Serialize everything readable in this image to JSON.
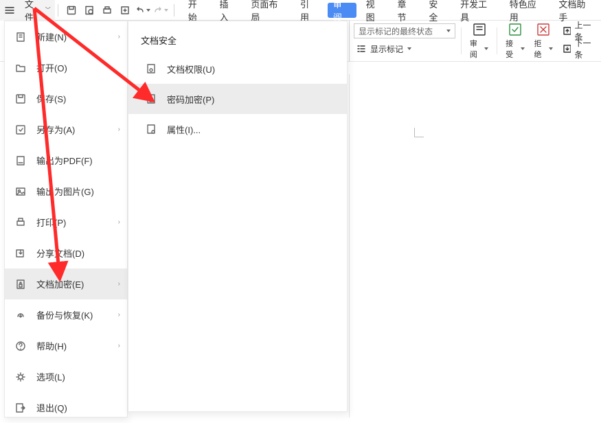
{
  "topbar": {
    "file_label": "文件"
  },
  "tabs": {
    "start": "开始",
    "insert": "插入",
    "layout": "页面布局",
    "reference": "引用",
    "review": "审阅",
    "view": "视图",
    "chapter": "章节",
    "security": "安全",
    "devtools": "开发工具",
    "special": "特色应用",
    "assistant": "文档助手"
  },
  "ribbon": {
    "mark_display_state": "显示标记的最终状态",
    "show_marks": "显示标记",
    "review_btn": "审阅",
    "accept_btn": "接受",
    "reject_btn": "拒绝",
    "prev": "上一条",
    "next": "下一条"
  },
  "file_menu": {
    "items": [
      {
        "id": "new",
        "label": "新建(N)",
        "arrow": true
      },
      {
        "id": "open",
        "label": "打开(O)",
        "arrow": false
      },
      {
        "id": "save",
        "label": "保存(S)",
        "arrow": false
      },
      {
        "id": "saveas",
        "label": "另存为(A)",
        "arrow": true
      },
      {
        "id": "exportpdf",
        "label": "输出为PDF(F)",
        "arrow": false
      },
      {
        "id": "exportimg",
        "label": "输出为图片(G)",
        "arrow": false
      },
      {
        "id": "print",
        "label": "打印(P)",
        "arrow": true
      },
      {
        "id": "share",
        "label": "分享文档(D)",
        "arrow": false
      },
      {
        "id": "encrypt",
        "label": "文档加密(E)",
        "arrow": true
      },
      {
        "id": "backup",
        "label": "备份与恢复(K)",
        "arrow": true
      },
      {
        "id": "help",
        "label": "帮助(H)",
        "arrow": true
      },
      {
        "id": "options",
        "label": "选项(L)",
        "arrow": false
      },
      {
        "id": "exit",
        "label": "退出(Q)",
        "arrow": false
      }
    ]
  },
  "submenu": {
    "header": "文档安全",
    "items": [
      {
        "id": "perm",
        "label": "文档权限(U)"
      },
      {
        "id": "encrypt",
        "label": "密码加密(P)"
      },
      {
        "id": "props",
        "label": "属性(I)..."
      }
    ]
  }
}
